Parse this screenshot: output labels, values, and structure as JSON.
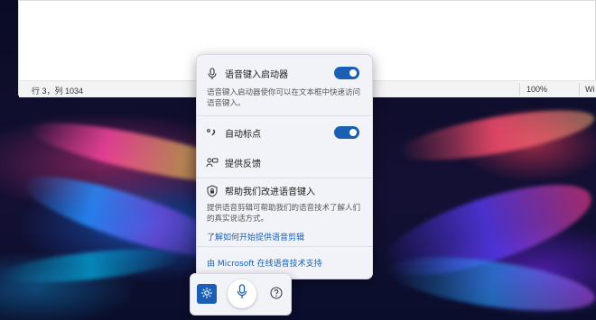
{
  "notepad": {
    "status_position": "行 3，列 1034",
    "status_zoom": "100%",
    "status_lineending": "Wi"
  },
  "popup": {
    "launcher": {
      "label": "语音键入启动器",
      "enabled": true,
      "description": "语音键入启动器使你可以在文本框中快速访问语音键入。"
    },
    "auto_punctuation": {
      "label": "自动标点",
      "enabled": true
    },
    "feedback": {
      "label": "提供反馈"
    },
    "improve": {
      "label": "帮助我们改进语音键入",
      "description": "提供语音剪辑可帮助我们的语音技术了解人们的真实说话方式。",
      "link": "了解如何开始提供语音剪辑"
    },
    "footer_link": "由 Microsoft 在线语音技术支持"
  },
  "toolbar": {
    "settings_icon": "gear-icon",
    "mic_icon": "microphone-icon",
    "help_icon": "help-icon"
  },
  "colors": {
    "accent": "#1a5fb4",
    "popup_bg": "#f2f3f8"
  }
}
